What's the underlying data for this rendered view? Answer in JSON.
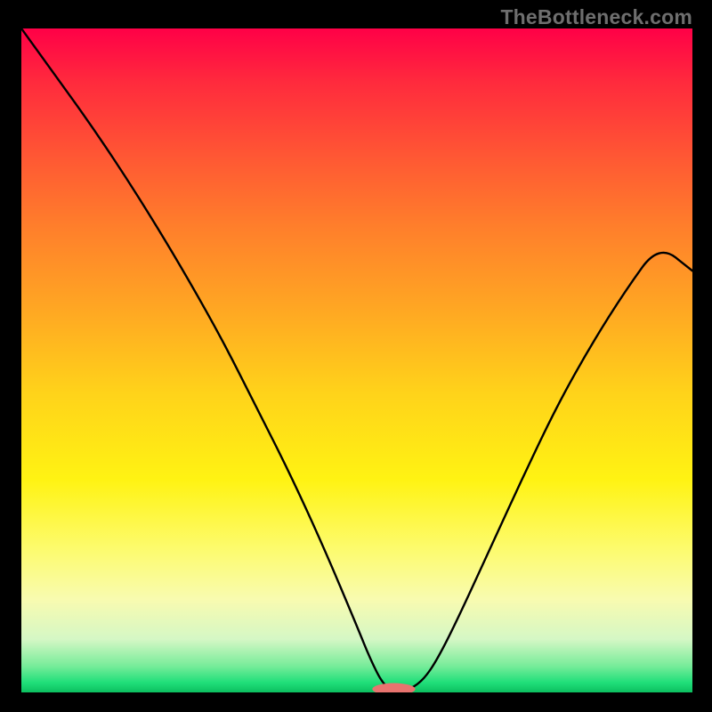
{
  "watermark_text": "TheBottleneck.com",
  "chart_data": {
    "type": "line",
    "title": "",
    "xlabel": "",
    "ylabel": "",
    "xlim": [
      0,
      100
    ],
    "ylim": [
      0,
      100
    ],
    "grid": false,
    "series": [
      {
        "name": "bottleneck-curve",
        "color": "#000000",
        "x": [
          0,
          5,
          10,
          15,
          20,
          25,
          30,
          35,
          40,
          45,
          50,
          52,
          54,
          56,
          58,
          60,
          62,
          65,
          70,
          75,
          80,
          85,
          90,
          95,
          100
        ],
        "y": [
          100,
          93,
          86,
          78.5,
          70.5,
          62,
          53,
          43,
          33,
          22,
          10,
          5,
          1,
          0,
          0.5,
          2,
          5,
          11,
          22,
          33,
          43.5,
          52.5,
          60.5,
          67.5,
          63.5
        ]
      }
    ],
    "marker": {
      "x": 55.5,
      "y": 0.5,
      "rx": 3.2,
      "ry": 0.9,
      "color": "#e8736f"
    },
    "background_gradient": {
      "direction": "top-to-bottom",
      "stops": [
        {
          "pos": 0,
          "color": "#ff0047"
        },
        {
          "pos": 0.3,
          "color": "#ff7f2b"
        },
        {
          "pos": 0.55,
          "color": "#ffd31a"
        },
        {
          "pos": 0.78,
          "color": "#fdfb6a"
        },
        {
          "pos": 0.96,
          "color": "#78ec9a"
        },
        {
          "pos": 1.0,
          "color": "#0cbf5f"
        }
      ]
    }
  }
}
